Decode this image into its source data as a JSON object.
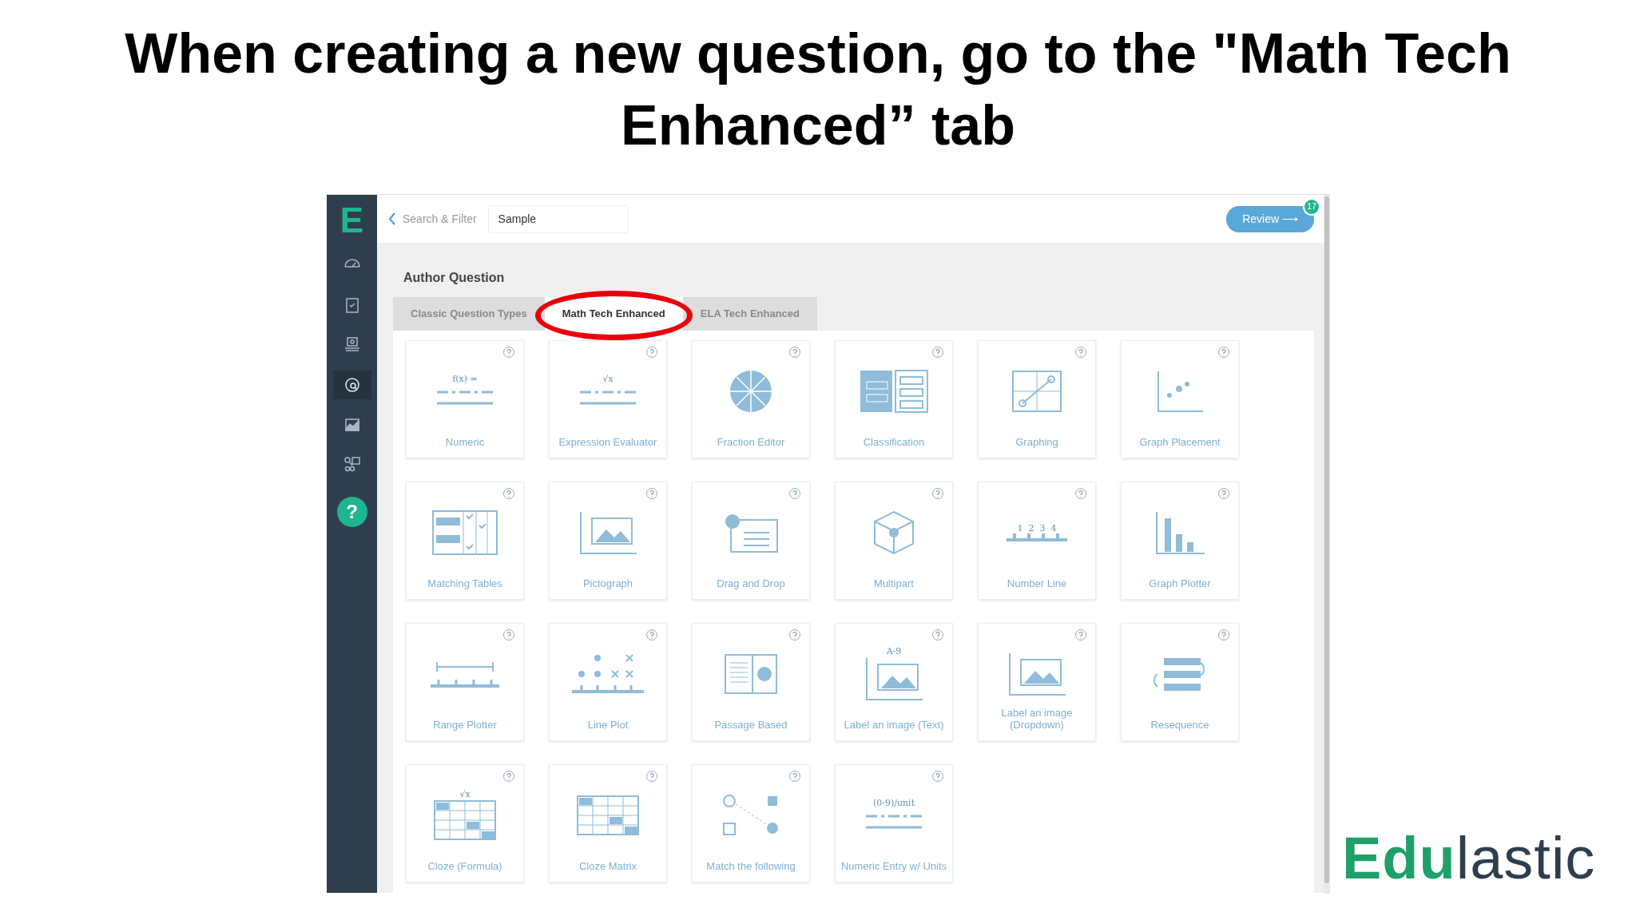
{
  "slide_title": "When creating a new question, go to the \"Math Tech Enhanced” tab",
  "app": {
    "logo": "E",
    "sidebar": [
      {
        "kind": "gauge",
        "selected": false
      },
      {
        "kind": "clipboard",
        "selected": false
      },
      {
        "kind": "tray",
        "selected": false
      },
      {
        "kind": "search",
        "selected": true
      },
      {
        "kind": "chart",
        "selected": false
      },
      {
        "kind": "network",
        "selected": false
      }
    ],
    "help": "?",
    "topbar": {
      "back": "Search & Filter",
      "search_value": "Sample",
      "review": "Review ⟶",
      "review_count": "17"
    },
    "heading": "Author Question",
    "tabs": [
      {
        "label": "Classic Question Types",
        "selected": false
      },
      {
        "label": "Math Tech Enhanced",
        "selected": true,
        "circled": true
      },
      {
        "label": "ELA Tech Enhanced",
        "selected": false
      }
    ],
    "cards": [
      {
        "label": "Numeric",
        "kind": "numeric",
        "icon_text": "f(x) ="
      },
      {
        "label": "Expression Evaluator",
        "kind": "numeric",
        "icon_text": "√x"
      },
      {
        "label": "Fraction Editor",
        "kind": "pie"
      },
      {
        "label": "Classification",
        "kind": "classification"
      },
      {
        "label": "Graphing",
        "kind": "graphing"
      },
      {
        "label": "Graph Placement",
        "kind": "placement"
      },
      {
        "label": "Matching Tables",
        "kind": "matching"
      },
      {
        "label": "Pictograph",
        "kind": "pictograph"
      },
      {
        "label": "Drag and Drop",
        "kind": "dragdrop"
      },
      {
        "label": "Multipart",
        "kind": "cube"
      },
      {
        "label": "Number Line",
        "kind": "numberline",
        "icon_text": "1  2  3  4"
      },
      {
        "label": "Graph Plotter",
        "kind": "bars"
      },
      {
        "label": "Range Plotter",
        "kind": "range"
      },
      {
        "label": "Line Plot",
        "kind": "lineplot"
      },
      {
        "label": "Passage Based",
        "kind": "passage"
      },
      {
        "label": "Label an image (Text)",
        "kind": "image",
        "icon_text": "A-9"
      },
      {
        "label": "Label an image (Dropdown)",
        "kind": "image"
      },
      {
        "label": "Resequence",
        "kind": "resequence"
      },
      {
        "label": "Cloze (Formula)",
        "kind": "table",
        "icon_text": "√x"
      },
      {
        "label": "Cloze Matrix",
        "kind": "table"
      },
      {
        "label": "Match the following",
        "kind": "match"
      },
      {
        "label": "Numeric Entry w/ Units",
        "kind": "numeric",
        "icon_text": "(0-9)/unit"
      }
    ]
  },
  "brand": {
    "bold": "Edu",
    "light": "lastic"
  }
}
